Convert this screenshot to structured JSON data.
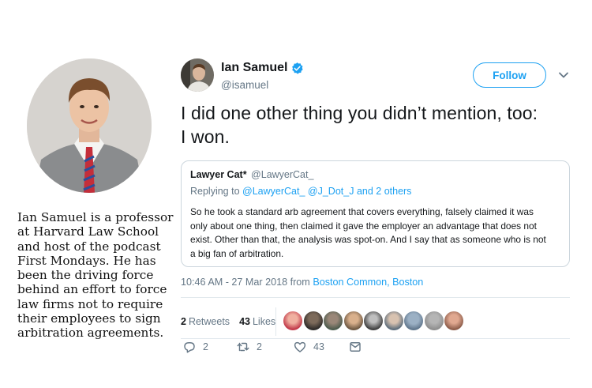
{
  "caption": {
    "lines": [
      "Ian Samuel is a professor",
      "at Harvard Law School",
      "and host of the podcast",
      "First Mondays. He has",
      "been the driving force",
      "behind an effort to force",
      "law firms not to require",
      "their employees to sign",
      "arbitration agreements."
    ]
  },
  "tweet": {
    "author_name": "Ian Samuel",
    "author_handle": "@isamuel",
    "verified_icon": "verified-badge-icon",
    "follow_label": "Follow",
    "menu_icon": "chevron-down-icon",
    "text_line1": "I did one other thing you didn’t mention, too:",
    "text_line2": "I won.",
    "quote": {
      "name": "Lawyer Cat*",
      "handle": "@LawyerCat_",
      "replying_prefix": "Replying to",
      "replying_mention1": "@LawyerCat_",
      "replying_mention2": "@J_Dot_J",
      "replying_suffix": "and 2 others",
      "body_lines": [
        "So he took a standard arb agreement that covers everything, falsely claimed it was",
        "only about one thing, then claimed it gave the employer an advantage that does not",
        "exist. Other than that, the analysis was spot-on. And I say that as someone who is not",
        "a big fan of arbitration."
      ]
    },
    "timestamp": "10:46 AM - 27 Mar 2018 from",
    "location": "Boston Common, Boston",
    "retweets_count": "2",
    "retweets_label": "Retweets",
    "likes_count": "43",
    "likes_label": "Likes",
    "likers_count_shown": 9,
    "actions": {
      "reply_count": "2",
      "retweet_count": "2",
      "like_count": "43"
    },
    "colors": {
      "accent": "#1da1f2",
      "secondary_text": "#657786",
      "border": "#ccd6dd"
    }
  }
}
